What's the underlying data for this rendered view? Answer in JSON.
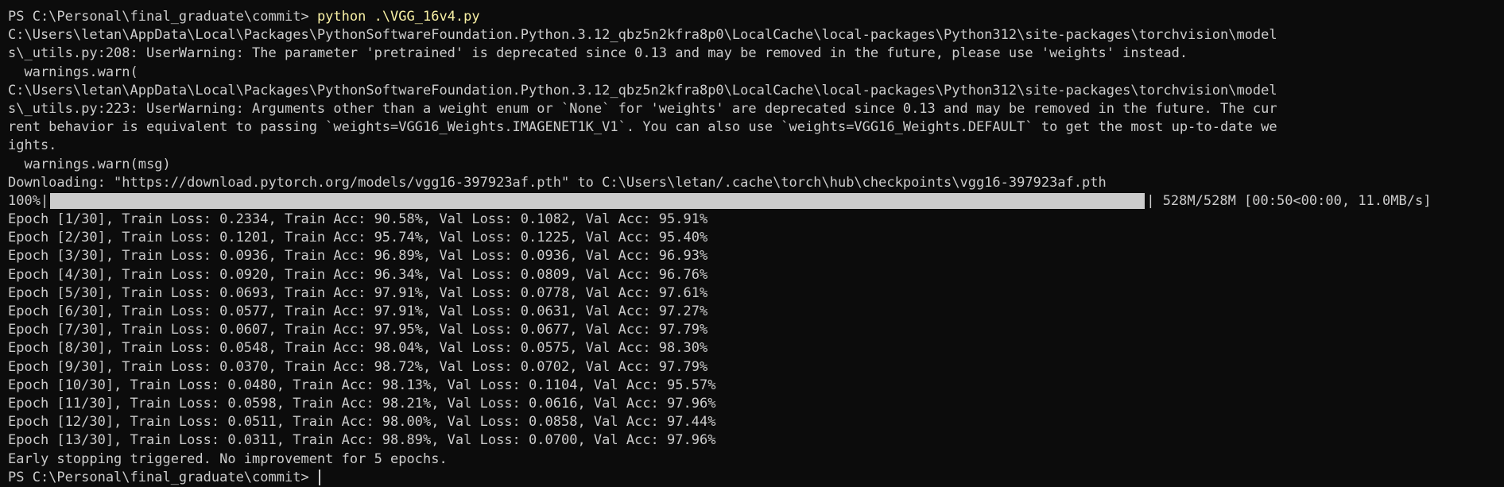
{
  "terminal": {
    "prompt1": "PS C:\\Personal\\final_graduate\\commit> ",
    "command": "python .\\VGG_16v4.py",
    "warn1_line1": "C:\\Users\\letan\\AppData\\Local\\Packages\\PythonSoftwareFoundation.Python.3.12_qbz5n2kfra8p0\\LocalCache\\local-packages\\Python312\\site-packages\\torchvision\\model",
    "warn1_line2": "s\\_utils.py:208: UserWarning: The parameter 'pretrained' is deprecated since 0.13 and may be removed in the future, please use 'weights' instead.",
    "warn1_line3": "  warnings.warn(",
    "warn2_line1": "C:\\Users\\letan\\AppData\\Local\\Packages\\PythonSoftwareFoundation.Python.3.12_qbz5n2kfra8p0\\LocalCache\\local-packages\\Python312\\site-packages\\torchvision\\model",
    "warn2_line2": "s\\_utils.py:223: UserWarning: Arguments other than a weight enum or `None` for 'weights' are deprecated since 0.13 and may be removed in the future. The cur",
    "warn2_line3": "rent behavior is equivalent to passing `weights=VGG16_Weights.IMAGENET1K_V1`. You can also use `weights=VGG16_Weights.DEFAULT` to get the most up-to-date we",
    "warn2_line4": "ights.",
    "warn2_line5": "  warnings.warn(msg)",
    "download": "Downloading: \"https://download.pytorch.org/models/vgg16-397923af.pth\" to C:\\Users\\letan/.cache\\torch\\hub\\checkpoints\\vgg16-397923af.pth",
    "progress_percent_label": "100%",
    "progress_sep": "|",
    "progress_fraction": 1.0,
    "progress_stats": " 528M/528M [00:50<00:00, 11.0MB/s]",
    "epochs": [
      "Epoch [1/30], Train Loss: 0.2334, Train Acc: 90.58%, Val Loss: 0.1082, Val Acc: 95.91%",
      "Epoch [2/30], Train Loss: 0.1201, Train Acc: 95.74%, Val Loss: 0.1225, Val Acc: 95.40%",
      "Epoch [3/30], Train Loss: 0.0936, Train Acc: 96.89%, Val Loss: 0.0936, Val Acc: 96.93%",
      "Epoch [4/30], Train Loss: 0.0920, Train Acc: 96.34%, Val Loss: 0.0809, Val Acc: 96.76%",
      "Epoch [5/30], Train Loss: 0.0693, Train Acc: 97.91%, Val Loss: 0.0778, Val Acc: 97.61%",
      "Epoch [6/30], Train Loss: 0.0577, Train Acc: 97.91%, Val Loss: 0.0631, Val Acc: 97.27%",
      "Epoch [7/30], Train Loss: 0.0607, Train Acc: 97.95%, Val Loss: 0.0677, Val Acc: 97.79%",
      "Epoch [8/30], Train Loss: 0.0548, Train Acc: 98.04%, Val Loss: 0.0575, Val Acc: 98.30%",
      "Epoch [9/30], Train Loss: 0.0370, Train Acc: 98.72%, Val Loss: 0.0702, Val Acc: 97.79%",
      "Epoch [10/30], Train Loss: 0.0480, Train Acc: 98.13%, Val Loss: 0.1104, Val Acc: 95.57%",
      "Epoch [11/30], Train Loss: 0.0598, Train Acc: 98.21%, Val Loss: 0.0616, Val Acc: 97.96%",
      "Epoch [12/30], Train Loss: 0.0511, Train Acc: 98.00%, Val Loss: 0.0858, Val Acc: 97.44%",
      "Epoch [13/30], Train Loss: 0.0311, Train Acc: 98.89%, Val Loss: 0.0700, Val Acc: 97.96%"
    ],
    "early_stop": "Early stopping triggered. No improvement for 5 epochs.",
    "prompt2": "PS C:\\Personal\\final_graduate\\commit> "
  },
  "colors": {
    "background": "#0c0c0c",
    "text": "#cccccc",
    "command": "#f9f1a5"
  }
}
